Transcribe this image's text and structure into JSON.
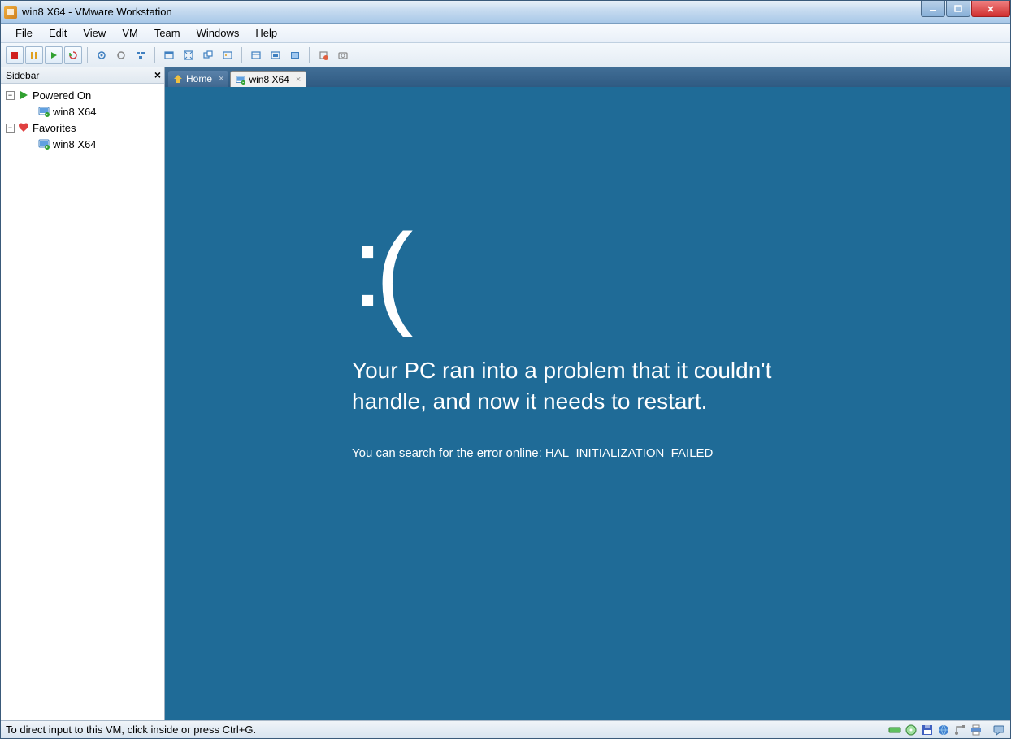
{
  "title": "win8 X64 - VMware Workstation",
  "menu": [
    "File",
    "Edit",
    "View",
    "VM",
    "Team",
    "Windows",
    "Help"
  ],
  "sidebar": {
    "title": "Sidebar",
    "groups": [
      {
        "label": "Powered On",
        "items": [
          "win8 X64"
        ]
      },
      {
        "label": "Favorites",
        "items": [
          "win8 X64"
        ]
      }
    ]
  },
  "tabs": [
    {
      "label": "Home",
      "active": false
    },
    {
      "label": "win8 X64",
      "active": true
    }
  ],
  "bsod": {
    "face": ":(",
    "message": "Your PC ran into a problem that it couldn't handle, and now it needs to restart.",
    "sub": "You can search for the error online: HAL_INITIALIZATION_FAILED"
  },
  "status": "To direct input to this VM, click inside or press Ctrl+G."
}
